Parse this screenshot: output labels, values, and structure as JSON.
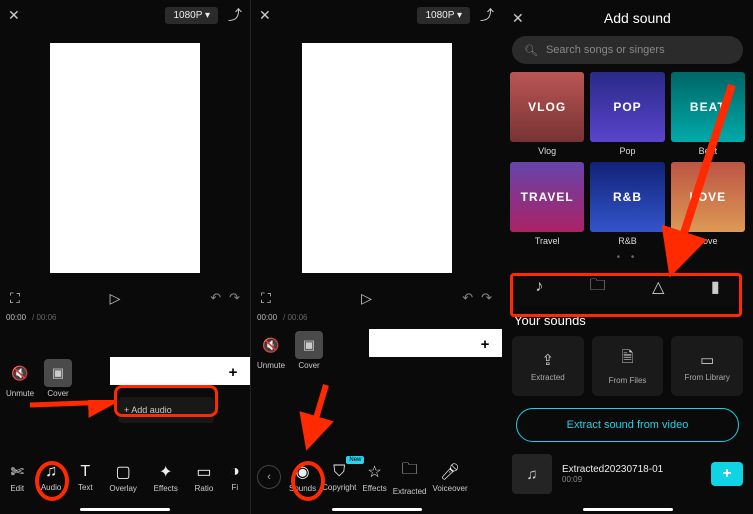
{
  "resolution": "1080P ▾",
  "timecodes": {
    "current": "00:00",
    "total": "/ 00:06"
  },
  "tl_controls": {
    "unmute": "Unmute",
    "cover": "Cover"
  },
  "add_audio": "+  Add audio",
  "toolbar1": {
    "edit": "Edit",
    "audio": "Audio",
    "text": "Text",
    "overlay": "Overlay",
    "effects": "Effects",
    "ratio": "Ratio",
    "fi": "Fi"
  },
  "toolbar2": {
    "sounds": "Sounds",
    "copyright": "Copyright",
    "effects": "Effects",
    "extracted": "Extracted",
    "voiceover": "Voiceover",
    "new_badge": "New"
  },
  "panel3": {
    "title": "Add sound",
    "search_placeholder": "Search songs or singers",
    "genres": [
      {
        "label": "Vlog",
        "tag": "VLOG"
      },
      {
        "label": "Pop",
        "tag": "POP"
      },
      {
        "label": "Beat",
        "tag": "BEAT"
      },
      {
        "label": "Travel",
        "tag": "TRAVEL"
      },
      {
        "label": "R&B",
        "tag": "R&B"
      },
      {
        "label": "Love",
        "tag": "LOVE"
      }
    ],
    "your_sounds_title": "Your sounds",
    "sound_sources": {
      "extracted": "Extracted",
      "from_files": "From Files",
      "from_library": "From Library"
    },
    "extract_btn": "Extract sound from video",
    "track": {
      "name": "Extracted20230718-01",
      "duration": "00:09"
    }
  }
}
